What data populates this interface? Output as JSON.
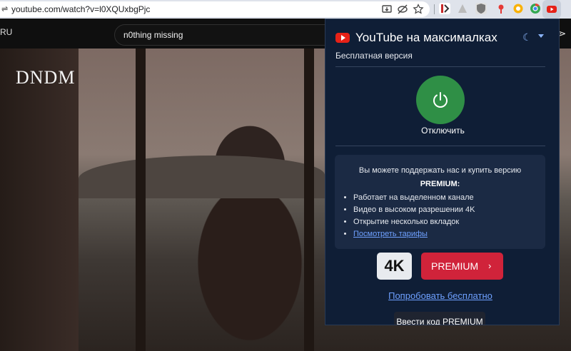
{
  "browser": {
    "url": "youtube.com/watch?v=l0XQUxbgPjc"
  },
  "youtube": {
    "region": "RU",
    "search_value": "n0thing missing",
    "video_overlay_text": "DNDM",
    "right_edge_glyph": "⋗"
  },
  "popup": {
    "title": "YouTube на максималках",
    "subtitle": "Бесплатная версия",
    "power_label": "Отключить",
    "card": {
      "heading": "Вы можете поддержать нас и купить версию",
      "premium_label": "PREMIUM:",
      "features": [
        "Работает на выделенном канале",
        "Видео в высоком разрешении 4K",
        "Открытие несколько вкладок"
      ],
      "tariffs_link": "Посмотреть тарифы"
    },
    "badge_4k": "4K",
    "premium_button": "PREMIUM",
    "try_free_link": "Попробовать бесплатно",
    "enter_code_button": "Ввести код PREMIUM"
  },
  "colors": {
    "popup_bg": "#0f1e36",
    "power_green": "#2f8f46",
    "premium_red": "#d0233a",
    "link_blue": "#6ea0ff"
  }
}
